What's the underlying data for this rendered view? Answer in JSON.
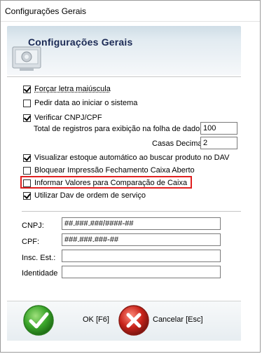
{
  "window": {
    "title": "Configurações Gerais"
  },
  "header": {
    "title": "Configurações Gerais"
  },
  "options": {
    "forcar_maiuscula": {
      "label": "Forçar letra maiúscula",
      "checked": true
    },
    "pedir_data": {
      "label": "Pedir data ao iniciar o sistema",
      "checked": false
    },
    "verificar_cnpj": {
      "label": "Verificar CNPJ/CPF",
      "checked": true
    },
    "visualizar_estoque": {
      "label": "Visualizar estoque automático ao buscar produto no DAV",
      "checked": true
    },
    "bloquear_impressao": {
      "label": "Bloquear Impressão Fechamento Caixa Aberto",
      "checked": false
    },
    "informar_valores": {
      "label": "Informar Valores para Comparação de Caixa",
      "checked": false
    },
    "utilizar_dav": {
      "label": "Utilizar Dav de ordem de serviço",
      "checked": true
    }
  },
  "fields": {
    "total_registros": {
      "label": "Total de registros para exibição na folha de dados:",
      "value": "100"
    },
    "casas_decimais": {
      "label": "Casas Decimais:",
      "value": "2"
    },
    "cnpj": {
      "label": "CNPJ:",
      "value": "##.###.###/####-##"
    },
    "cpf": {
      "label": "CPF:",
      "value": "###.###.###-##"
    },
    "insc_est": {
      "label": "Insc. Est.:",
      "value": ""
    },
    "identidade": {
      "label": "Identidade",
      "value": ""
    }
  },
  "buttons": {
    "ok": {
      "label": "OK [F6]",
      "icon": "check-icon"
    },
    "cancel": {
      "label": "Cancelar [Esc]",
      "icon": "cancel-x-icon"
    }
  },
  "colors": {
    "highlight": "#e02020",
    "ok_green": "#3aa52b",
    "cancel_red": "#c8231a",
    "header_title": "#1b2a55"
  }
}
